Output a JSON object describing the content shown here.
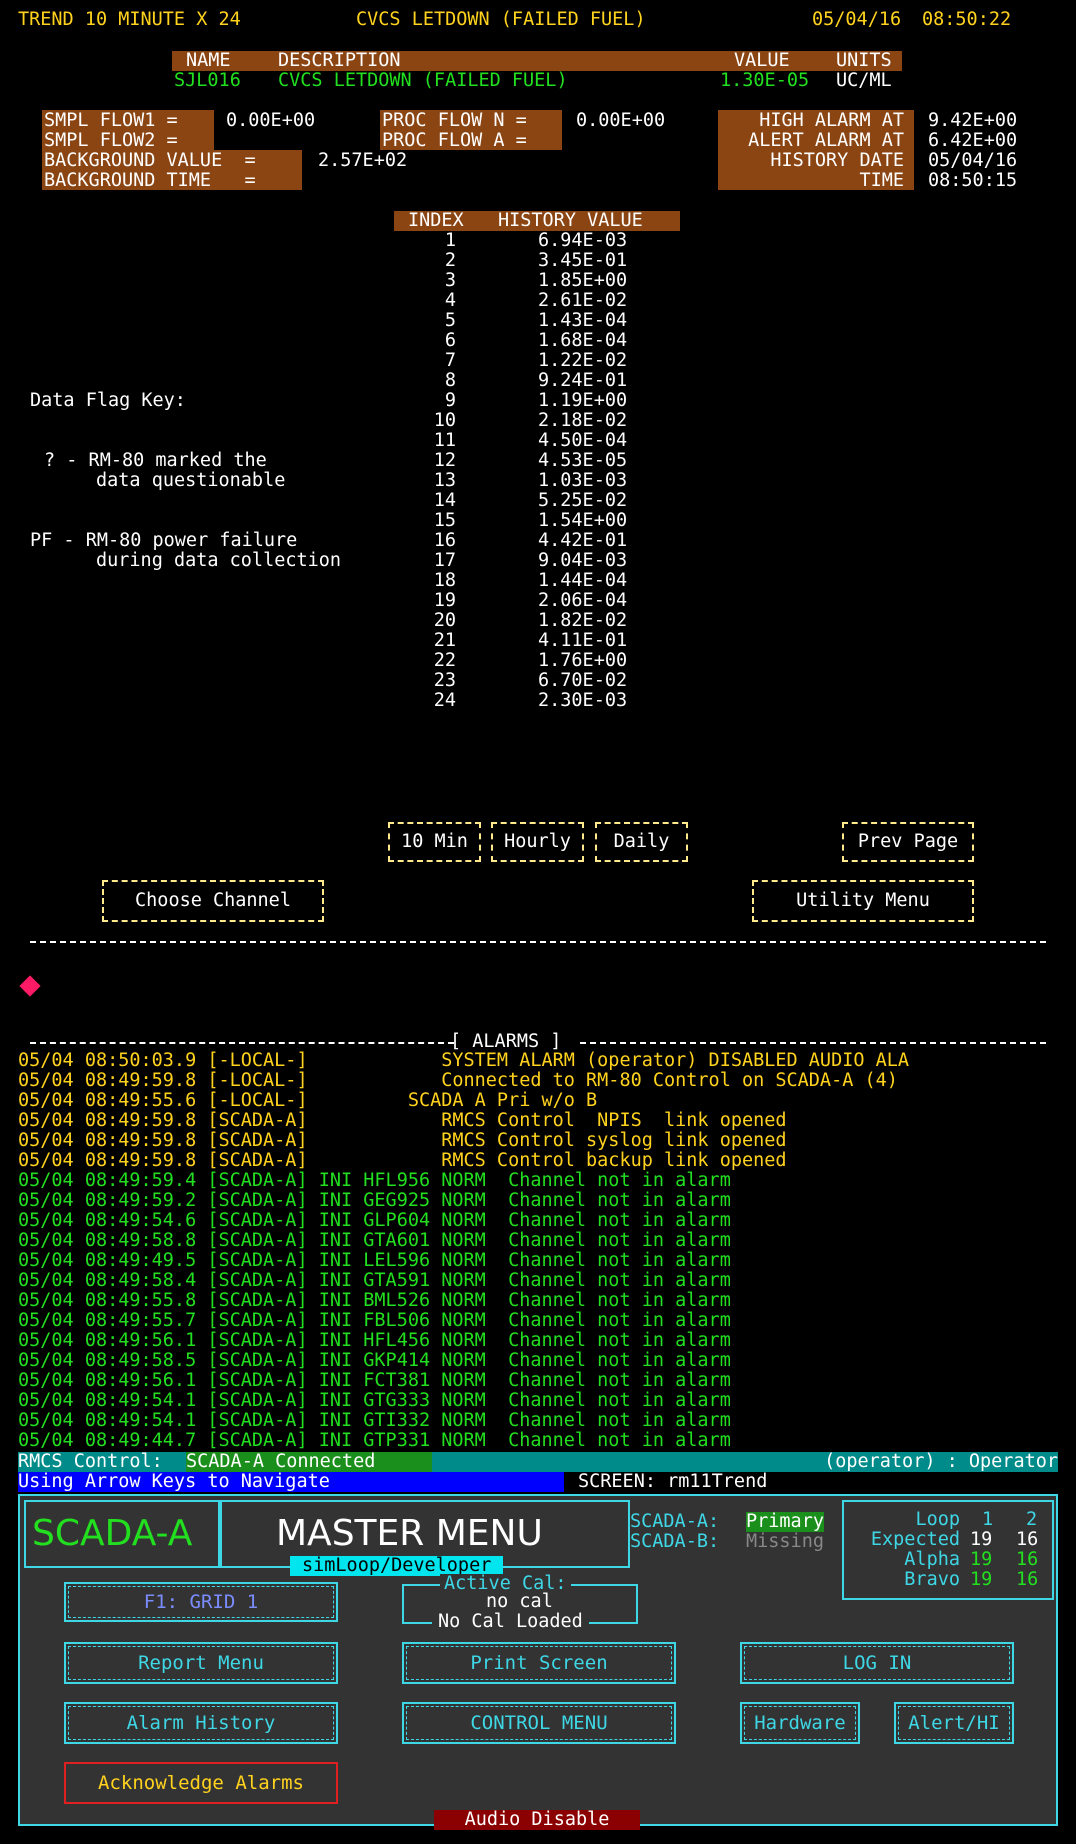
{
  "header": {
    "title": "TREND 10 MINUTE X 24",
    "channel_title": "CVCS LETDOWN (FAILED FUEL)",
    "date": "05/04/16",
    "time": "08:50:22"
  },
  "channel_table": {
    "headers": [
      "NAME",
      "DESCRIPTION",
      "VALUE",
      "UNITS"
    ],
    "name": "SJL016",
    "description": "CVCS LETDOWN (FAILED FUEL)",
    "value": "1.30E-05",
    "units": "UC/ML"
  },
  "params": {
    "smpl_flow1_label": "SMPL FLOW1 =",
    "smpl_flow1_value": "0.00E+00",
    "smpl_flow2_label": "SMPL FLOW2 =",
    "smpl_flow2_value": "",
    "background_value_label": "BACKGROUND VALUE  =",
    "background_value": "2.57E+02",
    "background_time_label": "BACKGROUND TIME   =",
    "background_time": "",
    "proc_flow_n_label": "PROC FLOW N =",
    "proc_flow_n_value": "0.00E+00",
    "proc_flow_a_label": "PROC FLOW A =",
    "proc_flow_a_value": "",
    "high_alarm_label": "HIGH ALARM AT",
    "high_alarm_value": "9.42E+00",
    "alert_alarm_label": "ALERT ALARM AT",
    "alert_alarm_value": "6.42E+00",
    "history_date_label": "HISTORY DATE",
    "history_date_value": "05/04/16",
    "time_label": "TIME",
    "time_value": "08:50:15"
  },
  "history": {
    "headers": [
      "INDEX",
      "HISTORY VALUE"
    ],
    "rows": [
      [
        "1",
        "6.94E-03"
      ],
      [
        "2",
        "3.45E-01"
      ],
      [
        "3",
        "1.85E+00"
      ],
      [
        "4",
        "2.61E-02"
      ],
      [
        "5",
        "1.43E-04"
      ],
      [
        "6",
        "1.68E-04"
      ],
      [
        "7",
        "1.22E-02"
      ],
      [
        "8",
        "9.24E-01"
      ],
      [
        "9",
        "1.19E+00"
      ],
      [
        "10",
        "2.18E-02"
      ],
      [
        "11",
        "4.50E-04"
      ],
      [
        "12",
        "4.53E-05"
      ],
      [
        "13",
        "1.03E-03"
      ],
      [
        "14",
        "5.25E-02"
      ],
      [
        "15",
        "1.54E+00"
      ],
      [
        "16",
        "4.42E-01"
      ],
      [
        "17",
        "9.04E-03"
      ],
      [
        "18",
        "1.44E-04"
      ],
      [
        "19",
        "2.06E-04"
      ],
      [
        "20",
        "1.82E-02"
      ],
      [
        "21",
        "4.11E-01"
      ],
      [
        "22",
        "1.76E+00"
      ],
      [
        "23",
        "6.70E-02"
      ],
      [
        "24",
        "2.30E-03"
      ]
    ]
  },
  "flag_key": {
    "title": "Data Flag Key:",
    "q_line1": "? - RM-80 marked the",
    "q_line2": "data questionable",
    "pf_line1": "PF - RM-80 power failure",
    "pf_line2": "during data collection"
  },
  "buttons": {
    "ten_min": "10 Min",
    "hourly": "Hourly",
    "daily": "Daily",
    "prev_page": "Prev Page",
    "choose_channel": "Choose Channel",
    "utility_menu": "Utility Menu"
  },
  "alarms": {
    "title": "[ ALARMS ]",
    "rows": [
      {
        "color": "#ffd21e",
        "text": "05/04 08:50:03.9 [-LOCAL-]            SYSTEM ALARM (operator) DISABLED AUDIO ALA"
      },
      {
        "color": "#ffd21e",
        "text": "05/04 08:49:59.8 [-LOCAL-]            Connected to RM-80 Control on SCADA-A (4)"
      },
      {
        "color": "#ffd21e",
        "text": "05/04 08:49:55.6 [-LOCAL-]         SCADA A Pri w/o B"
      },
      {
        "color": "#ffd21e",
        "text": "05/04 08:49:59.8 [SCADA-A]            RMCS Control  NPIS  link opened"
      },
      {
        "color": "#ffd21e",
        "text": "05/04 08:49:59.8 [SCADA-A]            RMCS Control syslog link opened"
      },
      {
        "color": "#ffd21e",
        "text": "05/04 08:49:59.8 [SCADA-A]            RMCS Control backup link opened"
      },
      {
        "color": "#22e01f",
        "text": "05/04 08:49:59.4 [SCADA-A] INI HFL956 NORM  Channel not in alarm"
      },
      {
        "color": "#22e01f",
        "text": "05/04 08:49:59.2 [SCADA-A] INI GEG925 NORM  Channel not in alarm"
      },
      {
        "color": "#22e01f",
        "text": "05/04 08:49:54.6 [SCADA-A] INI GLP604 NORM  Channel not in alarm"
      },
      {
        "color": "#22e01f",
        "text": "05/04 08:49:58.8 [SCADA-A] INI GTA601 NORM  Channel not in alarm"
      },
      {
        "color": "#22e01f",
        "text": "05/04 08:49:49.5 [SCADA-A] INI LEL596 NORM  Channel not in alarm"
      },
      {
        "color": "#22e01f",
        "text": "05/04 08:49:58.4 [SCADA-A] INI GTA591 NORM  Channel not in alarm"
      },
      {
        "color": "#22e01f",
        "text": "05/04 08:49:55.8 [SCADA-A] INI BML526 NORM  Channel not in alarm"
      },
      {
        "color": "#22e01f",
        "text": "05/04 08:49:55.7 [SCADA-A] INI FBL506 NORM  Channel not in alarm"
      },
      {
        "color": "#22e01f",
        "text": "05/04 08:49:56.1 [SCADA-A] INI HFL456 NORM  Channel not in alarm"
      },
      {
        "color": "#22e01f",
        "text": "05/04 08:49:58.5 [SCADA-A] INI GKP414 NORM  Channel not in alarm"
      },
      {
        "color": "#22e01f",
        "text": "05/04 08:49:56.1 [SCADA-A] INI FCT381 NORM  Channel not in alarm"
      },
      {
        "color": "#22e01f",
        "text": "05/04 08:49:54.1 [SCADA-A] INI GTG333 NORM  Channel not in alarm"
      },
      {
        "color": "#22e01f",
        "text": "05/04 08:49:54.1 [SCADA-A] INI GTI332 NORM  Channel not in alarm"
      },
      {
        "color": "#22e01f",
        "text": "05/04 08:49:44.7 [SCADA-A] INI GTP331 NORM  Channel not in alarm"
      }
    ]
  },
  "status": {
    "rmcs_label": "RMCS Control:",
    "rmcs_value": "SCADA-A Connected",
    "operator": "(operator) : Operator",
    "nav_hint": "Using Arrow Keys to Navigate",
    "screen": "SCREEN: rm11Trend"
  },
  "master_menu": {
    "system_name": "SCADA-A",
    "title": "MASTER MENU",
    "subtitle": "simLoop/Developer",
    "scada_a_label": "SCADA-A:",
    "scada_a_value": "Primary",
    "scada_b_label": "SCADA-B:",
    "scada_b_value": "Missing",
    "loop_label": "Loop",
    "loop1": "1",
    "loop2": "2",
    "expected_label": "Expected",
    "expected1": "19",
    "expected2": "16",
    "alpha_label": "Alpha",
    "alpha1": "19",
    "alpha2": "16",
    "bravo_label": "Bravo",
    "bravo1": "19",
    "bravo2": "16",
    "f1_label": "F1:   GRID 1",
    "active_cal_label": "Active Cal:",
    "active_cal_value": "no cal",
    "no_cal_loaded": "No Cal Loaded",
    "report_menu": "Report  Menu",
    "print_screen": "Print Screen",
    "log_in": "LOG IN",
    "alarm_history": "Alarm  History",
    "control_menu": "CONTROL MENU",
    "hardware": "Hardware",
    "alert_hi": "Alert/HI",
    "acknowledge": "Acknowledge Alarms",
    "audio_disable": "Audio Disable"
  },
  "colors": {
    "header_bg": "#8b4513",
    "yellow": "#ffd21e",
    "green": "#22e01f",
    "cyan": "#3ed7e6",
    "status_teal": "#008b8b",
    "nav_blue": "#0000ff",
    "audio_red": "#8b0000",
    "diamond": "#ff1a66"
  }
}
